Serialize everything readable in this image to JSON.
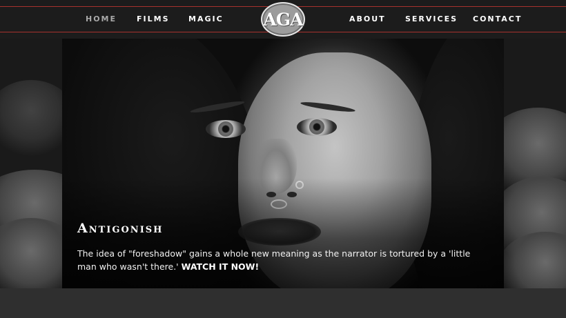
{
  "nav": {
    "left_items": [
      {
        "label": "HOME",
        "active": true
      },
      {
        "label": "FILMS",
        "active": false
      },
      {
        "label": "MAGIC",
        "active": false
      }
    ],
    "right_items": [
      {
        "label": "ABOUT",
        "active": false
      },
      {
        "label": "SERVICES",
        "active": false
      },
      {
        "label": "CONTACT",
        "active": false
      }
    ],
    "logo_text": "AGA"
  },
  "hero": {
    "title": "Antigonish",
    "description": "The idea of \"foreshadow\" gains a whole new meaning as the narrator is tortured by a 'little man who wasn't there.'",
    "cta_label": "WATCH IT NOW!"
  },
  "colors": {
    "nav_background": "#1c1c1c",
    "nav_rule": "#a8322e",
    "page_background": "#2e2e2e",
    "active_nav": "#a9a9a9"
  }
}
